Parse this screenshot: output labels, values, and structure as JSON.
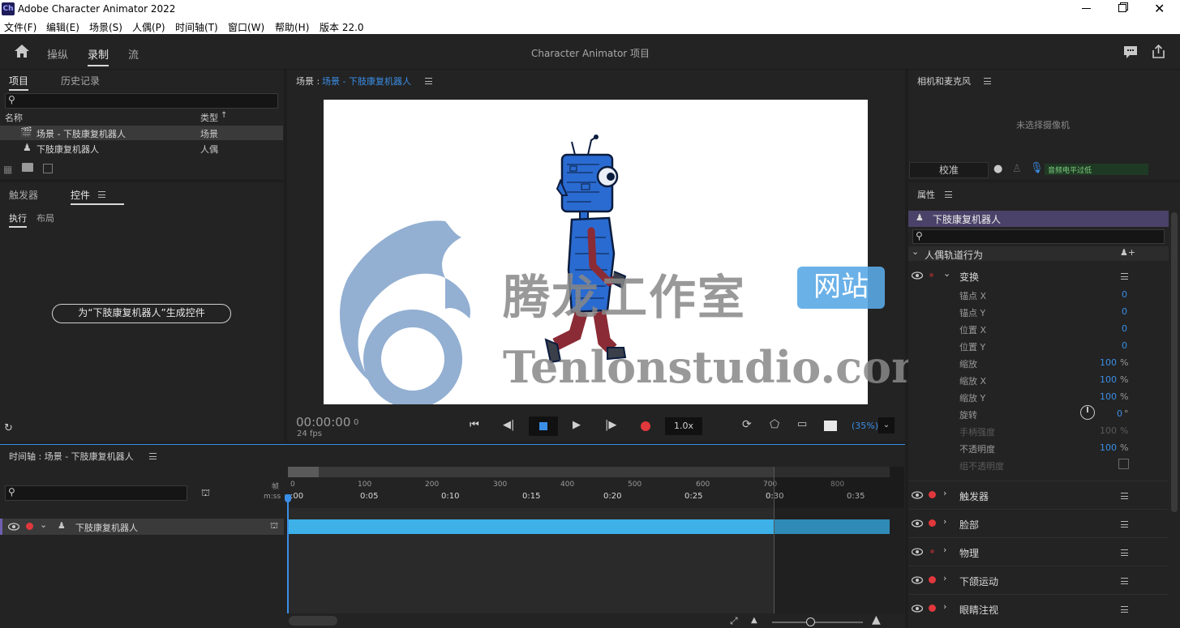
{
  "window": {
    "app_icon": "Ch",
    "title": "Adobe Character Animator 2022"
  },
  "menu": [
    "文件(F)",
    "编辑(E)",
    "场景(S)",
    "人偶(P)",
    "时间轴(T)",
    "窗口(W)",
    "帮助(H)",
    "版本 22.0"
  ],
  "appbar": {
    "tabs": [
      "操纵",
      "录制",
      "流"
    ],
    "active_tab": "录制",
    "title": "Character Animator 项目"
  },
  "project": {
    "tabs": [
      "项目",
      "历史记录"
    ],
    "col_name": "名称",
    "col_type": "类型",
    "rows": [
      {
        "name": "场景 - 下肢康复机器人",
        "type": "场景"
      },
      {
        "name": "下肢康复机器人",
        "type": "人偶"
      }
    ]
  },
  "controls": {
    "tabs": [
      "触发器",
      "控件"
    ],
    "subtabs": [
      "执行",
      "布局"
    ],
    "generate_button": "为“下肢康复机器人”生成控件"
  },
  "scene": {
    "label_prefix": "场景 : ",
    "name": "场景 - 下肢康复机器人",
    "timecode": "00:00:00",
    "frame": "0",
    "fps": "24 fps",
    "speed": "1.0x",
    "zoom": "(35%)"
  },
  "watermark": {
    "cn": "腾龙工作室",
    "badge": "网站",
    "en": "Tenlonstudio.com"
  },
  "camera": {
    "title": "相机和麦克风",
    "no_camera": "未选择摄像机",
    "calibrate": "校准",
    "audio_level": "音频电平过低"
  },
  "properties": {
    "title": "属性",
    "puppet_name": "下肢康复机器人",
    "section": "人偶轨道行为",
    "transform": "变换",
    "rows": [
      {
        "label": "锚点 X",
        "value": "0",
        "unit": ""
      },
      {
        "label": "锚点 Y",
        "value": "0",
        "unit": ""
      },
      {
        "label": "位置 X",
        "value": "0",
        "unit": ""
      },
      {
        "label": "位置 Y",
        "value": "0",
        "unit": ""
      },
      {
        "label": "缩放",
        "value": "100",
        "unit": "%"
      },
      {
        "label": "缩放 X",
        "value": "100",
        "unit": "%"
      },
      {
        "label": "缩放 Y",
        "value": "100",
        "unit": "%"
      },
      {
        "label": "旋转",
        "value": "0",
        "unit": "°"
      },
      {
        "label": "手柄强度",
        "value": "100",
        "unit": "%"
      },
      {
        "label": "不透明度",
        "value": "100",
        "unit": "%"
      },
      {
        "label": "组不透明度",
        "value": "",
        "unit": ""
      }
    ],
    "groups": [
      "触发器",
      "脸部",
      "物理",
      "下颌运动",
      "眼睛注视"
    ]
  },
  "timeline": {
    "title": "时间轴 : 场景 - 下肢康复机器人",
    "frame_label": "帧",
    "mss_label": "m:ss",
    "frames": [
      "0",
      "100",
      "200",
      "300",
      "400",
      "500",
      "600",
      "700",
      "800"
    ],
    "times": [
      ":00",
      "0:05",
      "0:10",
      "0:15",
      "0:20",
      "0:25",
      "0:30",
      "0:35"
    ],
    "track_name": "下肢康复机器人"
  },
  "colors": {
    "accent": "#3a8ee6",
    "track": "#3db1e8",
    "record": "#e0383c",
    "puppet_header": "#4a4268"
  }
}
